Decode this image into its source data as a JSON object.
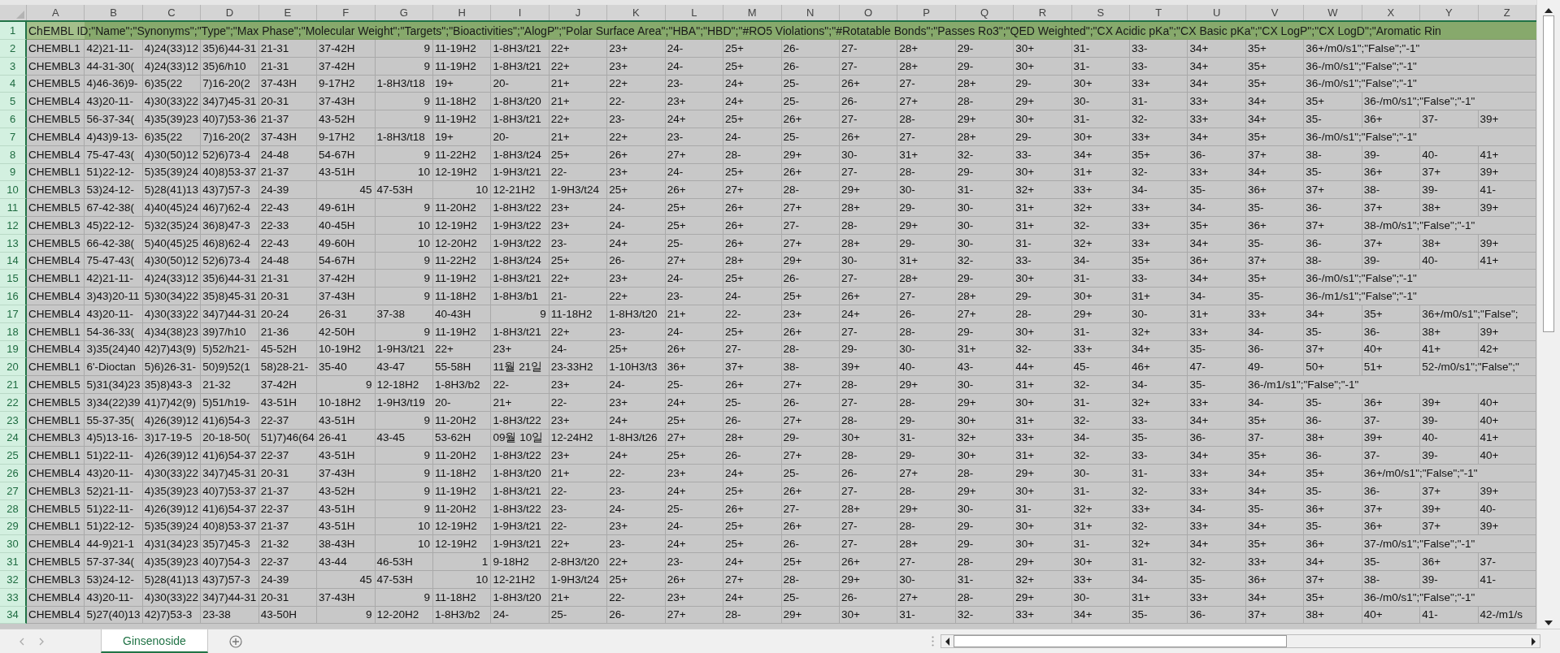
{
  "sheet": {
    "columns": [
      "A",
      "B",
      "C",
      "D",
      "E",
      "F",
      "G",
      "H",
      "I",
      "J",
      "K",
      "L",
      "M",
      "N",
      "O",
      "P",
      "Q",
      "R",
      "S",
      "T",
      "U",
      "V",
      "W",
      "X",
      "Y",
      "Z"
    ],
    "header_row": {
      "row": "1",
      "text": "ChEMBL ID;\"Name\";\"Synonyms\";\"Type\";\"Max Phase\";\"Molecular Weight\";\"Targets\";\"Bioactivities\";\"AlogP\";\"Polar Surface Area\";\"HBA\";\"HBD\";\"#RO5 Violations\";\"#Rotatable Bonds\";\"Passes Ro3\";\"QED Weighted\";\"CX Acidic pKa\";\"CX Basic pKa\";\"CX LogP\";\"CX LogD\";\"Aromatic Rin"
    },
    "rows": [
      {
        "row": "2",
        "cells": [
          "CHEMBL1",
          "42)21-11-",
          "4)24(33)12",
          "35)6)44-31",
          "21-31",
          "37-42H",
          {
            "kind": "number",
            "text": "9"
          },
          "11-19H2",
          "1-8H3/t21",
          "22+",
          "23+",
          "24-",
          "25+",
          "26-",
          "27-",
          "28+",
          "29-",
          "30+",
          "31-",
          "33-",
          "34+",
          "35+",
          "36+/m0/s1\";\"False\";\"-1\""
        ]
      },
      {
        "row": "3",
        "cells": [
          "CHEMBL3",
          "44-31-30(",
          "4)24(33)12",
          "35)6/h10",
          "21-31",
          "37-42H",
          {
            "kind": "number",
            "text": "9"
          },
          "11-19H2",
          "1-8H3/t21",
          "22+",
          "23+",
          "24-",
          "25+",
          "26-",
          "27-",
          "28+",
          "29-",
          "30+",
          "31-",
          "33-",
          "34+",
          "35+",
          "36-/m0/s1\";\"False\";\"-1\""
        ]
      },
      {
        "row": "4",
        "cells": [
          "CHEMBL5",
          "4)46-36)9-",
          "6)35(22",
          "7)16-20(2",
          "37-43H",
          "9-17H2",
          "1-8H3/t18",
          "19+",
          "20-",
          "21+",
          "22+",
          "23-",
          "24+",
          "25-",
          "26+",
          "27-",
          "28+",
          "29-",
          "30+",
          "33+",
          "34+",
          "35+",
          "36-/m0/s1\";\"False\";\"-1\""
        ]
      },
      {
        "row": "5",
        "cells": [
          "CHEMBL4",
          "43)20-11-",
          "4)30(33)22",
          "34)7)45-31",
          "20-31",
          "37-43H",
          {
            "kind": "number",
            "text": "9"
          },
          "11-18H2",
          "1-8H3/t20",
          "21+",
          "22-",
          "23+",
          "24+",
          "25-",
          "26-",
          "27+",
          "28-",
          "29+",
          "30-",
          "31-",
          "33+",
          "34+",
          "35+",
          "36-/m0/s1\";\"False\";\"-1\""
        ]
      },
      {
        "row": "6",
        "cells": [
          "CHEMBL5",
          "56-37-34(",
          "4)35(39)23",
          "40)7)53-36",
          "21-37",
          "43-52H",
          {
            "kind": "number",
            "text": "9"
          },
          "11-19H2",
          "1-8H3/t21",
          "22+",
          "23-",
          "24+",
          "25+",
          "26+",
          "27-",
          "28-",
          "29+",
          "30+",
          "31-",
          "32-",
          "33+",
          "34+",
          "35-",
          "36+",
          "37-",
          "39+"
        ]
      },
      {
        "row": "7",
        "cells": [
          "CHEMBL4",
          "4)43)9-13-",
          "6)35(22",
          "7)16-20(2",
          "37-43H",
          "9-17H2",
          "1-8H3/t18",
          "19+",
          "20-",
          "21+",
          "22+",
          "23-",
          "24-",
          "25-",
          "26+",
          "27-",
          "28+",
          "29-",
          "30+",
          "33+",
          "34+",
          "35+",
          "36-/m0/s1\";\"False\";\"-1\""
        ]
      },
      {
        "row": "8",
        "cells": [
          "CHEMBL4",
          "75-47-43(",
          "4)30(50)12",
          "52)6)73-4",
          "24-48",
          "54-67H",
          {
            "kind": "number",
            "text": "9"
          },
          "11-22H2",
          "1-8H3/t24",
          "25+",
          "26+",
          "27+",
          "28-",
          "29+",
          "30-",
          "31+",
          "32-",
          "33-",
          "34+",
          "35+",
          "36-",
          "37+",
          "38-",
          "39-",
          "40-",
          "41+"
        ]
      },
      {
        "row": "9",
        "cells": [
          "CHEMBL1",
          "51)22-12-",
          "5)35(39)24",
          "40)8)53-37",
          "21-37",
          "43-51H",
          {
            "kind": "number",
            "text": "10"
          },
          "12-19H2",
          "1-9H3/t21",
          "22-",
          "23+",
          "24-",
          "25+",
          "26+",
          "27-",
          "28-",
          "29-",
          "30+",
          "31+",
          "32-",
          "33+",
          "34+",
          "35-",
          "36+",
          "37+",
          "39+"
        ]
      },
      {
        "row": "10",
        "cells": [
          "CHEMBL3",
          "53)24-12-",
          "5)28(41)13",
          "43)7)57-3",
          "24-39",
          {
            "kind": "number",
            "text": "45"
          },
          "47-53H",
          {
            "kind": "number",
            "text": "10"
          },
          "12-21H2",
          "1-9H3/t24",
          "25+",
          "26+",
          "27+",
          "28-",
          "29+",
          "30-",
          "31-",
          "32+",
          "33+",
          "34-",
          "35-",
          "36+",
          "37+",
          "38-",
          "39-",
          "41-"
        ]
      },
      {
        "row": "11",
        "cells": [
          "CHEMBL5",
          "67-42-38(",
          "4)40(45)24",
          "46)7)62-4",
          "22-43",
          "49-61H",
          {
            "kind": "number",
            "text": "9"
          },
          "11-20H2",
          "1-8H3/t22",
          "23+",
          "24-",
          "25+",
          "26+",
          "27+",
          "28+",
          "29-",
          "30-",
          "31+",
          "32+",
          "33+",
          "34-",
          "35-",
          "36-",
          "37+",
          "38+",
          "39+"
        ]
      },
      {
        "row": "12",
        "cells": [
          "CHEMBL3",
          "45)22-12-",
          "5)32(35)24",
          "36)8)47-3",
          "22-33",
          "40-45H",
          {
            "kind": "number",
            "text": "10"
          },
          "12-19H2",
          "1-9H3/t22",
          "23+",
          "24-",
          "25+",
          "26+",
          "27-",
          "28-",
          "29+",
          "30-",
          "31+",
          "32-",
          "33+",
          "35+",
          "36+",
          "37+",
          "38-/m0/s1\";\"False\";\"-1\""
        ]
      },
      {
        "row": "13",
        "cells": [
          "CHEMBL5",
          "66-42-38(",
          "5)40(45)25",
          "46)8)62-4",
          "22-43",
          "49-60H",
          {
            "kind": "number",
            "text": "10"
          },
          "12-20H2",
          "1-9H3/t22",
          "23-",
          "24+",
          "25-",
          "26+",
          "27+",
          "28+",
          "29-",
          "30-",
          "31-",
          "32+",
          "33+",
          "34+",
          "35-",
          "36-",
          "37+",
          "38+",
          "39+"
        ]
      },
      {
        "row": "14",
        "cells": [
          "CHEMBL4",
          "75-47-43(",
          "4)30(50)12",
          "52)6)73-4",
          "24-48",
          "54-67H",
          {
            "kind": "number",
            "text": "9"
          },
          "11-22H2",
          "1-8H3/t24",
          "25+",
          "26-",
          "27+",
          "28+",
          "29+",
          "30-",
          "31+",
          "32-",
          "33-",
          "34-",
          "35+",
          "36+",
          "37+",
          "38-",
          "39-",
          "40-",
          "41+"
        ]
      },
      {
        "row": "15",
        "cells": [
          "CHEMBL1",
          "42)21-11-",
          "4)24(33)12",
          "35)6)44-31",
          "21-31",
          "37-42H",
          {
            "kind": "number",
            "text": "9"
          },
          "11-19H2",
          "1-8H3/t21",
          "22+",
          "23+",
          "24-",
          "25+",
          "26-",
          "27-",
          "28+",
          "29-",
          "30+",
          "31-",
          "33-",
          "34+",
          "35+",
          "36-/m0/s1\";\"False\";\"-1\""
        ]
      },
      {
        "row": "16",
        "cells": [
          "CHEMBL4",
          "3)43)20-11",
          "5)30(34)22",
          "35)8)45-31",
          "20-31",
          "37-43H",
          {
            "kind": "number",
            "text": "9"
          },
          "11-18H2",
          "1-8H3/b1",
          "21-",
          "22+",
          "23-",
          "24-",
          "25+",
          "26+",
          "27-",
          "28+",
          "29-",
          "30+",
          "31+",
          "34-",
          "35-",
          "36-/m1/s1\";\"False\";\"-1\""
        ]
      },
      {
        "row": "17",
        "cells": [
          "CHEMBL4",
          "43)20-11-",
          "4)30(33)22",
          "34)7)44-31",
          "20-24",
          "26-31",
          "37-38",
          "40-43H",
          {
            "kind": "number",
            "text": "9"
          },
          "11-18H2",
          "1-8H3/t20",
          "21+",
          "22-",
          "23+",
          "24+",
          "26-",
          "27+",
          "28-",
          "29+",
          "30-",
          "31+",
          "33+",
          "34+",
          "35+",
          "36+/m0/s1\";\"False\";"
        ]
      },
      {
        "row": "18",
        "cells": [
          "CHEMBL1",
          "54-36-33(",
          "4)34(38)23",
          "39)7/h10",
          "21-36",
          "42-50H",
          {
            "kind": "number",
            "text": "9"
          },
          "11-19H2",
          "1-8H3/t21",
          "22+",
          "23-",
          "24-",
          "25+",
          "26+",
          "27-",
          "28-",
          "29-",
          "30+",
          "31-",
          "32+",
          "33+",
          "34-",
          "35-",
          "36-",
          "38+",
          "39+"
        ]
      },
      {
        "row": "19",
        "cells": [
          "CHEMBL4",
          "3)35(24)40",
          "42)7)43(9)",
          "5)52/h21-",
          "45-52H",
          "10-19H2",
          "1-9H3/t21",
          "22+",
          "23+",
          "24-",
          "25+",
          "26+",
          "27-",
          "28-",
          "29-",
          "30-",
          "31+",
          "32-",
          "33+",
          "34+",
          "35-",
          "36-",
          "37+",
          "40+",
          "41+",
          "42+"
        ]
      },
      {
        "row": "20",
        "cells": [
          "CHEMBL1",
          "6'-Dioctan",
          "5)6)26-31-",
          "50)9)52(1",
          "58)28-21-",
          "35-40",
          "43-47",
          "55-58H",
          "11월 21일",
          "23-33H2",
          "1-10H3/t3",
          "36+",
          "37+",
          "38-",
          "39+",
          "40-",
          "43-",
          "44+",
          "45-",
          "46+",
          "47-",
          "49-",
          "50+",
          "51+",
          "52-/m0/s1\";\"False\";\""
        ]
      },
      {
        "row": "21",
        "cells": [
          "CHEMBL5",
          "5)31(34)23",
          "35)8)43-3",
          "21-32",
          "37-42H",
          {
            "kind": "number",
            "text": "9"
          },
          "12-18H2",
          "1-8H3/b2",
          "22-",
          "23+",
          "24-",
          "25-",
          "26+",
          "27+",
          "28-",
          "29+",
          "30-",
          "31+",
          "32-",
          "34-",
          "35-",
          "36-/m1/s1\";\"False\";\"-1\""
        ]
      },
      {
        "row": "22",
        "cells": [
          "CHEMBL5",
          "3)34(22)39",
          "41)7)42(9)",
          "5)51/h19-",
          "43-51H",
          "10-18H2",
          "1-9H3/t19",
          "20-",
          "21+",
          "22-",
          "23+",
          "24+",
          "25-",
          "26-",
          "27-",
          "28-",
          "29+",
          "30+",
          "31-",
          "32+",
          "33+",
          "34-",
          "35-",
          "36+",
          "39+",
          "40+"
        ]
      },
      {
        "row": "23",
        "cells": [
          "CHEMBL1",
          "55-37-35(",
          "4)26(39)12",
          "41)6)54-3",
          "22-37",
          "43-51H",
          {
            "kind": "number",
            "text": "9"
          },
          "11-20H2",
          "1-8H3/t22",
          "23+",
          "24+",
          "25+",
          "26-",
          "27+",
          "28-",
          "29-",
          "30+",
          "31+",
          "32-",
          "33-",
          "34+",
          "35+",
          "36-",
          "37-",
          "39-",
          "40+"
        ]
      },
      {
        "row": "24",
        "cells": [
          "CHEMBL3",
          "4)5)13-16-",
          "3)17-19-5",
          "20-18-50(",
          "51)7)46(64",
          "26-41",
          "43-45",
          "53-62H",
          "09월 10일",
          "12-24H2",
          "1-8H3/t26",
          "27+",
          "28+",
          "29-",
          "30+",
          "31-",
          "32+",
          "33+",
          "34-",
          "35-",
          "36-",
          "37-",
          "38+",
          "39+",
          "40-",
          "41+"
        ]
      },
      {
        "row": "25",
        "cells": [
          "CHEMBL1",
          "51)22-11-",
          "4)26(39)12",
          "41)6)54-37",
          "22-37",
          "43-51H",
          {
            "kind": "number",
            "text": "9"
          },
          "11-20H2",
          "1-8H3/t22",
          "23+",
          "24+",
          "25+",
          "26-",
          "27+",
          "28-",
          "29-",
          "30+",
          "31+",
          "32-",
          "33-",
          "34+",
          "35+",
          "36-",
          "37-",
          "39-",
          "40+"
        ]
      },
      {
        "row": "26",
        "cells": [
          "CHEMBL4",
          "43)20-11-",
          "4)30(33)22",
          "34)7)45-31",
          "20-31",
          "37-43H",
          {
            "kind": "number",
            "text": "9"
          },
          "11-18H2",
          "1-8H3/t20",
          "21+",
          "22-",
          "23+",
          "24+",
          "25-",
          "26-",
          "27+",
          "28-",
          "29+",
          "30-",
          "31-",
          "33+",
          "34+",
          "35+",
          "36+/m0/s1\";\"False\";\"-1\""
        ]
      },
      {
        "row": "27",
        "cells": [
          "CHEMBL3",
          "52)21-11-",
          "4)35(39)23",
          "40)7)53-37",
          "21-37",
          "43-52H",
          {
            "kind": "number",
            "text": "9"
          },
          "11-19H2",
          "1-8H3/t21",
          "22-",
          "23-",
          "24+",
          "25+",
          "26+",
          "27-",
          "28-",
          "29+",
          "30+",
          "31-",
          "32-",
          "33+",
          "34+",
          "35-",
          "36-",
          "37+",
          "39+"
        ]
      },
      {
        "row": "28",
        "cells": [
          "CHEMBL5",
          "51)22-11-",
          "4)26(39)12",
          "41)6)54-37",
          "22-37",
          "43-51H",
          {
            "kind": "number",
            "text": "9"
          },
          "11-20H2",
          "1-8H3/t22",
          "23-",
          "24-",
          "25-",
          "26+",
          "27-",
          "28+",
          "29+",
          "30-",
          "31-",
          "32+",
          "33+",
          "34-",
          "35-",
          "36+",
          "37+",
          "39+",
          "40-"
        ]
      },
      {
        "row": "29",
        "cells": [
          "CHEMBL1",
          "51)22-12-",
          "5)35(39)24",
          "40)8)53-37",
          "21-37",
          "43-51H",
          {
            "kind": "number",
            "text": "10"
          },
          "12-19H2",
          "1-9H3/t21",
          "22-",
          "23+",
          "24-",
          "25+",
          "26+",
          "27-",
          "28-",
          "29-",
          "30+",
          "31+",
          "32-",
          "33+",
          "34+",
          "35-",
          "36+",
          "37+",
          "39+"
        ]
      },
      {
        "row": "30",
        "cells": [
          "CHEMBL4",
          "44-9)21-1",
          "4)31(34)23",
          "35)7)45-3",
          "21-32",
          "38-43H",
          {
            "kind": "number",
            "text": "10"
          },
          "12-19H2",
          "1-9H3/t21",
          "22+",
          "23-",
          "24+",
          "25+",
          "26-",
          "27-",
          "28+",
          "29-",
          "30+",
          "31-",
          "32+",
          "34+",
          "35+",
          "36+",
          "37-/m0/s1\";\"False\";\"-1\""
        ]
      },
      {
        "row": "31",
        "cells": [
          "CHEMBL5",
          "57-37-34(",
          "4)35(39)23",
          "40)7)54-3",
          "22-37",
          "43-44",
          "46-53H",
          {
            "kind": "number",
            "text": "1"
          },
          "9-18H2",
          "2-8H3/t20",
          "22+",
          "23-",
          "24+",
          "25+",
          "26+",
          "27-",
          "28-",
          "29+",
          "30+",
          "31-",
          "32-",
          "33+",
          "34+",
          "35-",
          "36+",
          "37-"
        ]
      },
      {
        "row": "32",
        "cells": [
          "CHEMBL3",
          "53)24-12-",
          "5)28(41)13",
          "43)7)57-3",
          "24-39",
          {
            "kind": "number",
            "text": "45"
          },
          "47-53H",
          {
            "kind": "number",
            "text": "10"
          },
          "12-21H2",
          "1-9H3/t24",
          "25+",
          "26+",
          "27+",
          "28-",
          "29+",
          "30-",
          "31-",
          "32+",
          "33+",
          "34-",
          "35-",
          "36+",
          "37+",
          "38-",
          "39-",
          "41-"
        ]
      },
      {
        "row": "33",
        "cells": [
          "CHEMBL4",
          "43)20-11-",
          "4)30(33)22",
          "34)7)44-31",
          "20-31",
          "37-43H",
          {
            "kind": "number",
            "text": "9"
          },
          "11-18H2",
          "1-8H3/t20",
          "21+",
          "22-",
          "23+",
          "24+",
          "25-",
          "26-",
          "27+",
          "28-",
          "29+",
          "30-",
          "31+",
          "33+",
          "34+",
          "35+",
          "36-/m0/s1\";\"False\";\"-1\""
        ]
      },
      {
        "row": "34",
        "cells": [
          "CHEMBL4",
          "5)27(40)13",
          "42)7)53-3",
          "23-38",
          "43-50H",
          {
            "kind": "number",
            "text": "9"
          },
          "12-20H2",
          "1-8H3/b2",
          "24-",
          "25-",
          "26-",
          "27+",
          "28-",
          "29+",
          "30+",
          "31-",
          "32-",
          "33+",
          "34+",
          "35-",
          "36-",
          "37+",
          "38+",
          "40+",
          "41-",
          "42-/m1/s"
        ]
      }
    ]
  },
  "tabs": [
    {
      "label": "Ginsenoside",
      "selected": true
    }
  ]
}
